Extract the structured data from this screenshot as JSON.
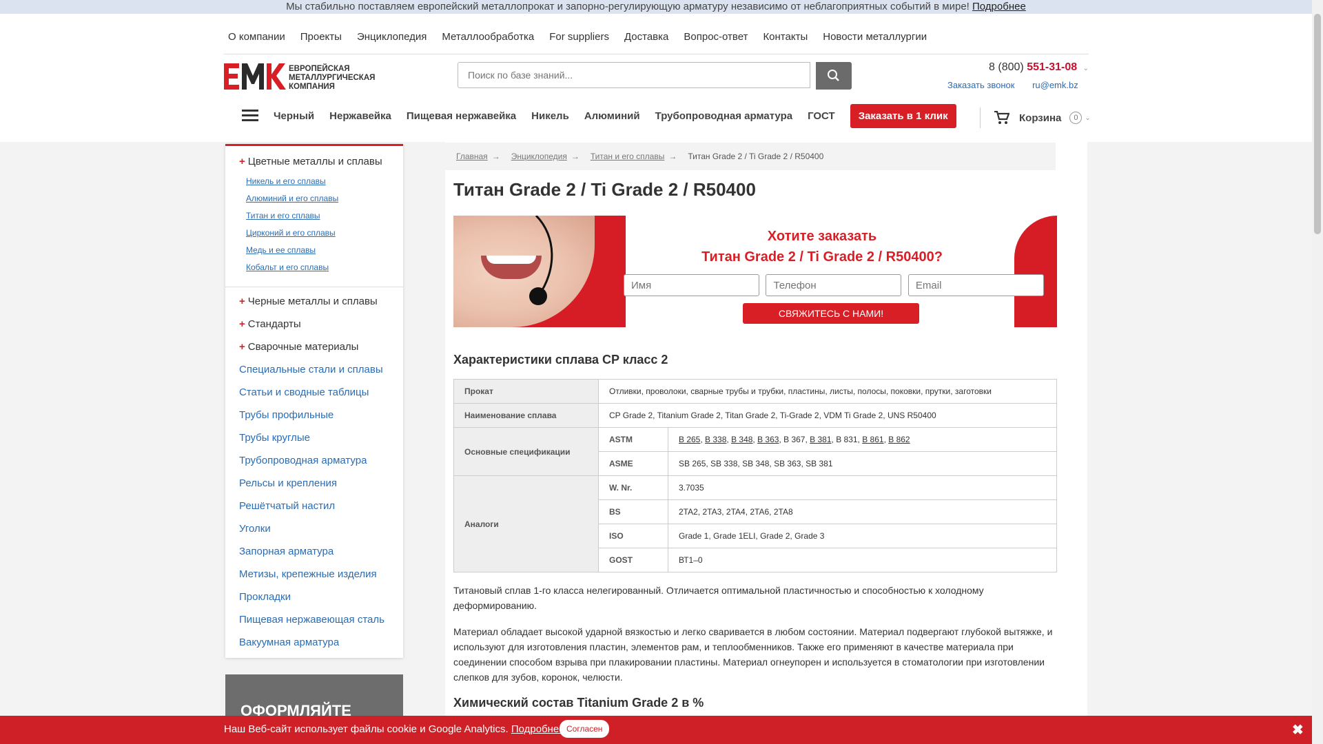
{
  "topbar": {
    "text": "Мы стабильно поставляем европейский металлопрокат и запорно-регулирующую арматуру независимо от неблагоприятных событий в мире!",
    "link": "Подробнее"
  },
  "topnav": [
    "О компании",
    "Проекты",
    "Энциклопедия",
    "Металлообработка",
    "For suppliers",
    "Доставка",
    "Вопрос-ответ",
    "Контакты",
    "Новости металлургии"
  ],
  "logo": {
    "mark": "EMK",
    "line1": "ЕВРОПЕЙСКАЯ",
    "line2": "МЕТАЛЛУРГИЧЕСКАЯ",
    "line3": "КОМПАНИЯ",
    "accent": "#d81f26"
  },
  "search": {
    "placeholder": "Поиск по базе знаний...",
    "icon": "search-icon"
  },
  "phone": {
    "prefix": "8 (800)",
    "number": "551-31-08"
  },
  "contacts": {
    "callback": "Заказать звонок",
    "email": "ru@emk.bz"
  },
  "mainnav": {
    "items": [
      "Черный",
      "Нержавейка",
      "Пищевая нержавейка",
      "Никель",
      "Алюминий",
      "Трубопроводная арматура",
      "ГОСТ"
    ],
    "quick_order": "Заказать в 1 клик"
  },
  "cart": {
    "label": "Корзина",
    "count": "0"
  },
  "sidebar": {
    "group": {
      "title": "Цветные металлы и сплавы",
      "subs": [
        "Никель и его сплавы",
        "Алюминий и его сплавы",
        "Титан и его сплавы",
        "Цирконий и его сплавы",
        "Медь и ее сплавы",
        "Кобальт и его сплавы"
      ]
    },
    "plus_items": [
      "Черные металлы и сплавы",
      "Стандарты",
      "Сварочные материалы"
    ],
    "links": [
      "Специальные стали и сплавы",
      "Статьи и сводные таблицы",
      "Трубы профильные",
      "Трубы круглые",
      "Трубопроводная арматура",
      "Рельсы и крепления",
      "Решётчатый настил",
      "Уголки",
      "Запорная арматура",
      "Метизы, крепежные изделия",
      "Прокладки",
      "Пищевая нержавеющая сталь",
      "Вакуумная арматура"
    ],
    "promo": "ОФОРМЛЯЙТЕ"
  },
  "breadcrumbs": {
    "items": [
      "Главная",
      "Энциклопедия",
      "Титан и его сплавы"
    ],
    "current": "Титан Grade 2 / Ti Grade 2 / R50400"
  },
  "title": "Титан Grade 2 / Ti Grade 2 / R50400",
  "banner": {
    "line1": "Хотите заказать",
    "line2": "Титан Grade 2 / Ti Grade 2 / R50400?",
    "name_placeholder": "Имя",
    "phone_placeholder": "Телефон",
    "email_placeholder": "Email",
    "button": "СВЯЖИТЕСЬ С НАМИ!"
  },
  "spec": {
    "heading": "Характеристики сплава CP класс 2",
    "prokat_label": "Прокат",
    "prokat_value": "Отливки, проволоки, сварные трубы и трубки, пластины, листы, полосы, поковки, прутки, заготовки",
    "name_label": "Наименование сплава",
    "name_value": "CP Grade 2, Titanium Grade 2, Titan Grade 2, Ti-Grade 2, VDM Ti Grade 2, UNS R50400",
    "main_label": "Основные спецификации",
    "astm_label": "ASTM",
    "astm": [
      "B 265",
      "B 338",
      "B 348",
      "B 363",
      "B 367",
      "B 381",
      "B 831",
      "B 861",
      "B 862"
    ],
    "asme_label": "ASME",
    "asme_value": "SB 265, SB 338, SB 348, SB 363, SB 381",
    "analogs_label": "Аналоги",
    "analogs": [
      {
        "std": "W. Nr.",
        "value": "3.7035"
      },
      {
        "std": "BS",
        "value": "2TA2, 2TA3, 2TA4, 2TA6, 2TA8"
      },
      {
        "std": "ISO",
        "value": "Grade 1, Grade 1ELI, Grade 2, Grade 3"
      },
      {
        "std": "GOST",
        "value": "ВТ1–0"
      }
    ]
  },
  "paragraphs": [
    "Титановый сплав 1-го класса нелегированный. Отличается оптимальной пластичностью и способностью к холодному деформированию.",
    "Материал обладает высокой ударной вязкостью и легко сваривается в любом состоянии. Материал подвергают глубокой вытяжке, и используют для изготовления пластин, элементов рам, и теплообменников. Также его применяют в качестве материала при соединении способом взрыва при плакировании пластины. Материал огнеупорен и используется в стоматологии при изготовлении слепков для зубов, коронок, челюсти."
  ],
  "chem_heading": "Химический состав Titanium Grade 2 в %",
  "cookie": {
    "text": "Наш Веб-сайт использует файлы cookie и Google Analytics.",
    "link": "Подробнее",
    "accept": "Согласен",
    "close": "✖"
  }
}
